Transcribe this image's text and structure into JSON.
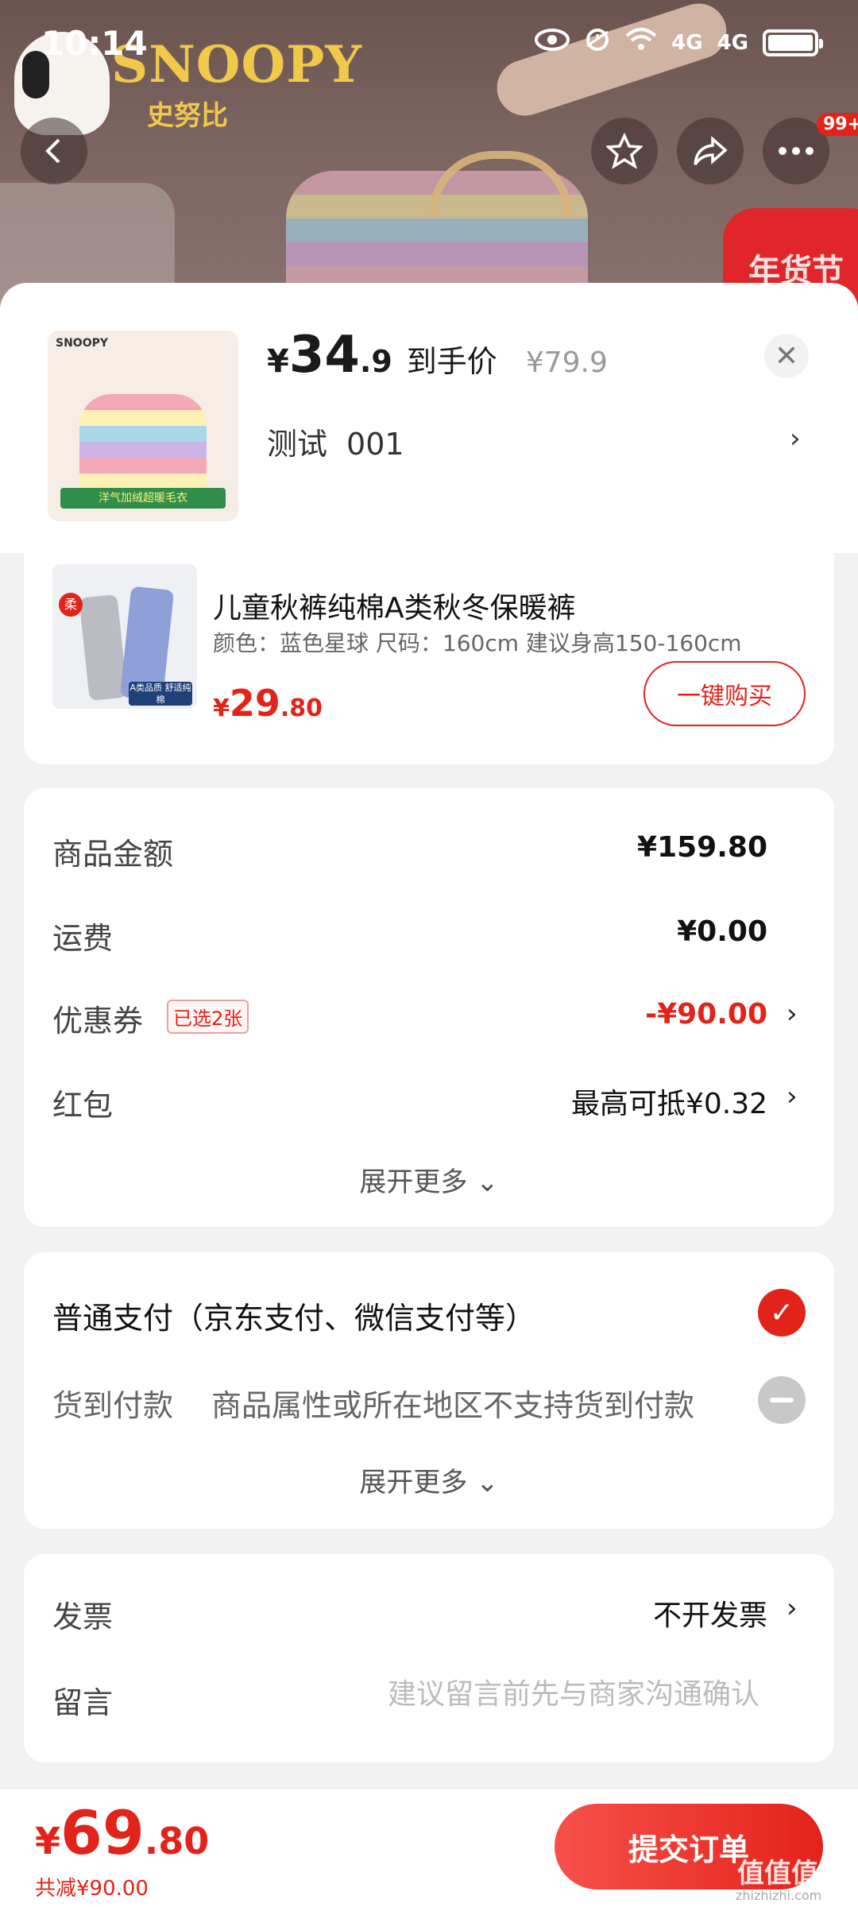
{
  "status_bar": {
    "time": "10:14",
    "signal_label_1": "4G",
    "signal_label_2": "4G"
  },
  "banner": {
    "brand": "SNOOPY",
    "brand_cn": "史努比",
    "promo_tag": "年货节"
  },
  "nav": {
    "more_badge": "99+"
  },
  "product": {
    "price_currency": "¥",
    "price_int": "34",
    "price_dec": ".9",
    "price_tag": "到手价",
    "original_price": "¥79.9",
    "spec_label": "测试",
    "spec_value": "001",
    "thumb_brand": "SNOOPY",
    "thumb_caption": "洋气加绒超暖毛衣"
  },
  "item": {
    "title": "儿童秋裤纯棉A类秋冬保暖裤",
    "spec": "颜色：蓝色星球   尺码：160cm 建议身高150-160cm",
    "price_currency": "¥",
    "price_int": "29",
    "price_dec": ".80",
    "buy_label": "一键购买",
    "badge_soft": "柔",
    "badge_quality": "A类品质 舒适纯棉"
  },
  "summary": {
    "goods_amount_label": "商品金额",
    "goods_amount_value": "¥159.80",
    "shipping_label": "运费",
    "shipping_value": "¥0.00",
    "coupon_label": "优惠券",
    "coupon_tag": "已选2张",
    "coupon_value": "-¥90.00",
    "redpacket_label": "红包",
    "redpacket_value": "最高可抵¥0.32",
    "expand_label": "展开更多 ⌄"
  },
  "payment": {
    "normal_label": "普通支付（京东支付、微信支付等）",
    "cod_label": "货到付款",
    "cod_note": "商品属性或所在地区不支持货到付款",
    "expand_label": "展开更多 ⌄"
  },
  "extra": {
    "invoice_label": "发票",
    "invoice_value": "不开发票",
    "message_label": "留言",
    "message_placeholder": "建议留言前先与商家沟通确认"
  },
  "footer": {
    "total_currency": "¥",
    "total_int": "69",
    "total_dec": ".80",
    "saved": "共减¥90.00",
    "submit_label": "提交订单",
    "watermark": "值值值",
    "watermark_sub": "zhizhizhi.com"
  },
  "colors": {
    "accent": "#e2231a",
    "background": "#f2f2f2"
  },
  "icons": [
    "back-icon",
    "star-icon",
    "share-icon",
    "more-icon",
    "close-icon",
    "chevron-right-icon",
    "check-icon",
    "minus-icon",
    "wifi-icon",
    "alarm-icon",
    "eye-icon",
    "battery-icon"
  ]
}
